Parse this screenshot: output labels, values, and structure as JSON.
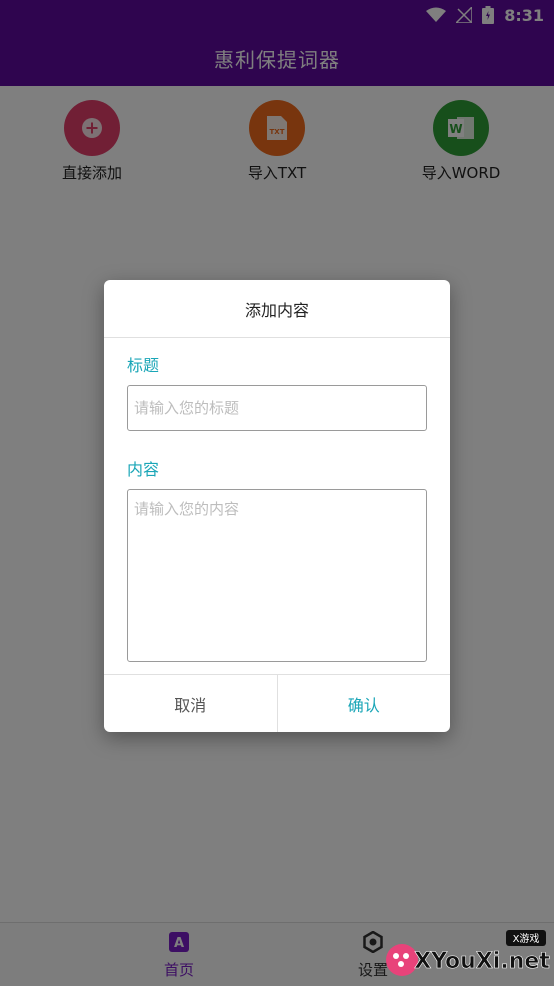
{
  "status_bar": {
    "time": "8:31",
    "icons": [
      "wifi-icon",
      "no-signal-icon",
      "battery-icon"
    ]
  },
  "toolbar": {
    "title": "惠利保提词器"
  },
  "actions": [
    {
      "label": "直接添加",
      "icon": "plus-icon",
      "color": "#e33f6a"
    },
    {
      "label": "导入TXT",
      "icon": "txt-file-icon",
      "color": "#f06a1c"
    },
    {
      "label": "导入WORD",
      "icon": "word-icon",
      "color": "#2f9e36"
    }
  ],
  "dialog": {
    "title": "添加内容",
    "title_field": {
      "label": "标题",
      "placeholder": "请输入您的标题",
      "value": ""
    },
    "content_field": {
      "label": "内容",
      "placeholder": "请输入您的内容",
      "value": ""
    },
    "cancel_label": "取消",
    "confirm_label": "确认"
  },
  "bottom_nav": [
    {
      "label": "首页",
      "icon": "home-a-icon",
      "active": true
    },
    {
      "label": "设置",
      "icon": "settings-icon",
      "active": false
    }
  ],
  "watermark": {
    "text": "XYouXi.net",
    "badge": "X游戏"
  },
  "colors": {
    "primary": "#5e0b9e",
    "accent": "#1aa6b7",
    "nav_active": "#7b1fc8"
  }
}
